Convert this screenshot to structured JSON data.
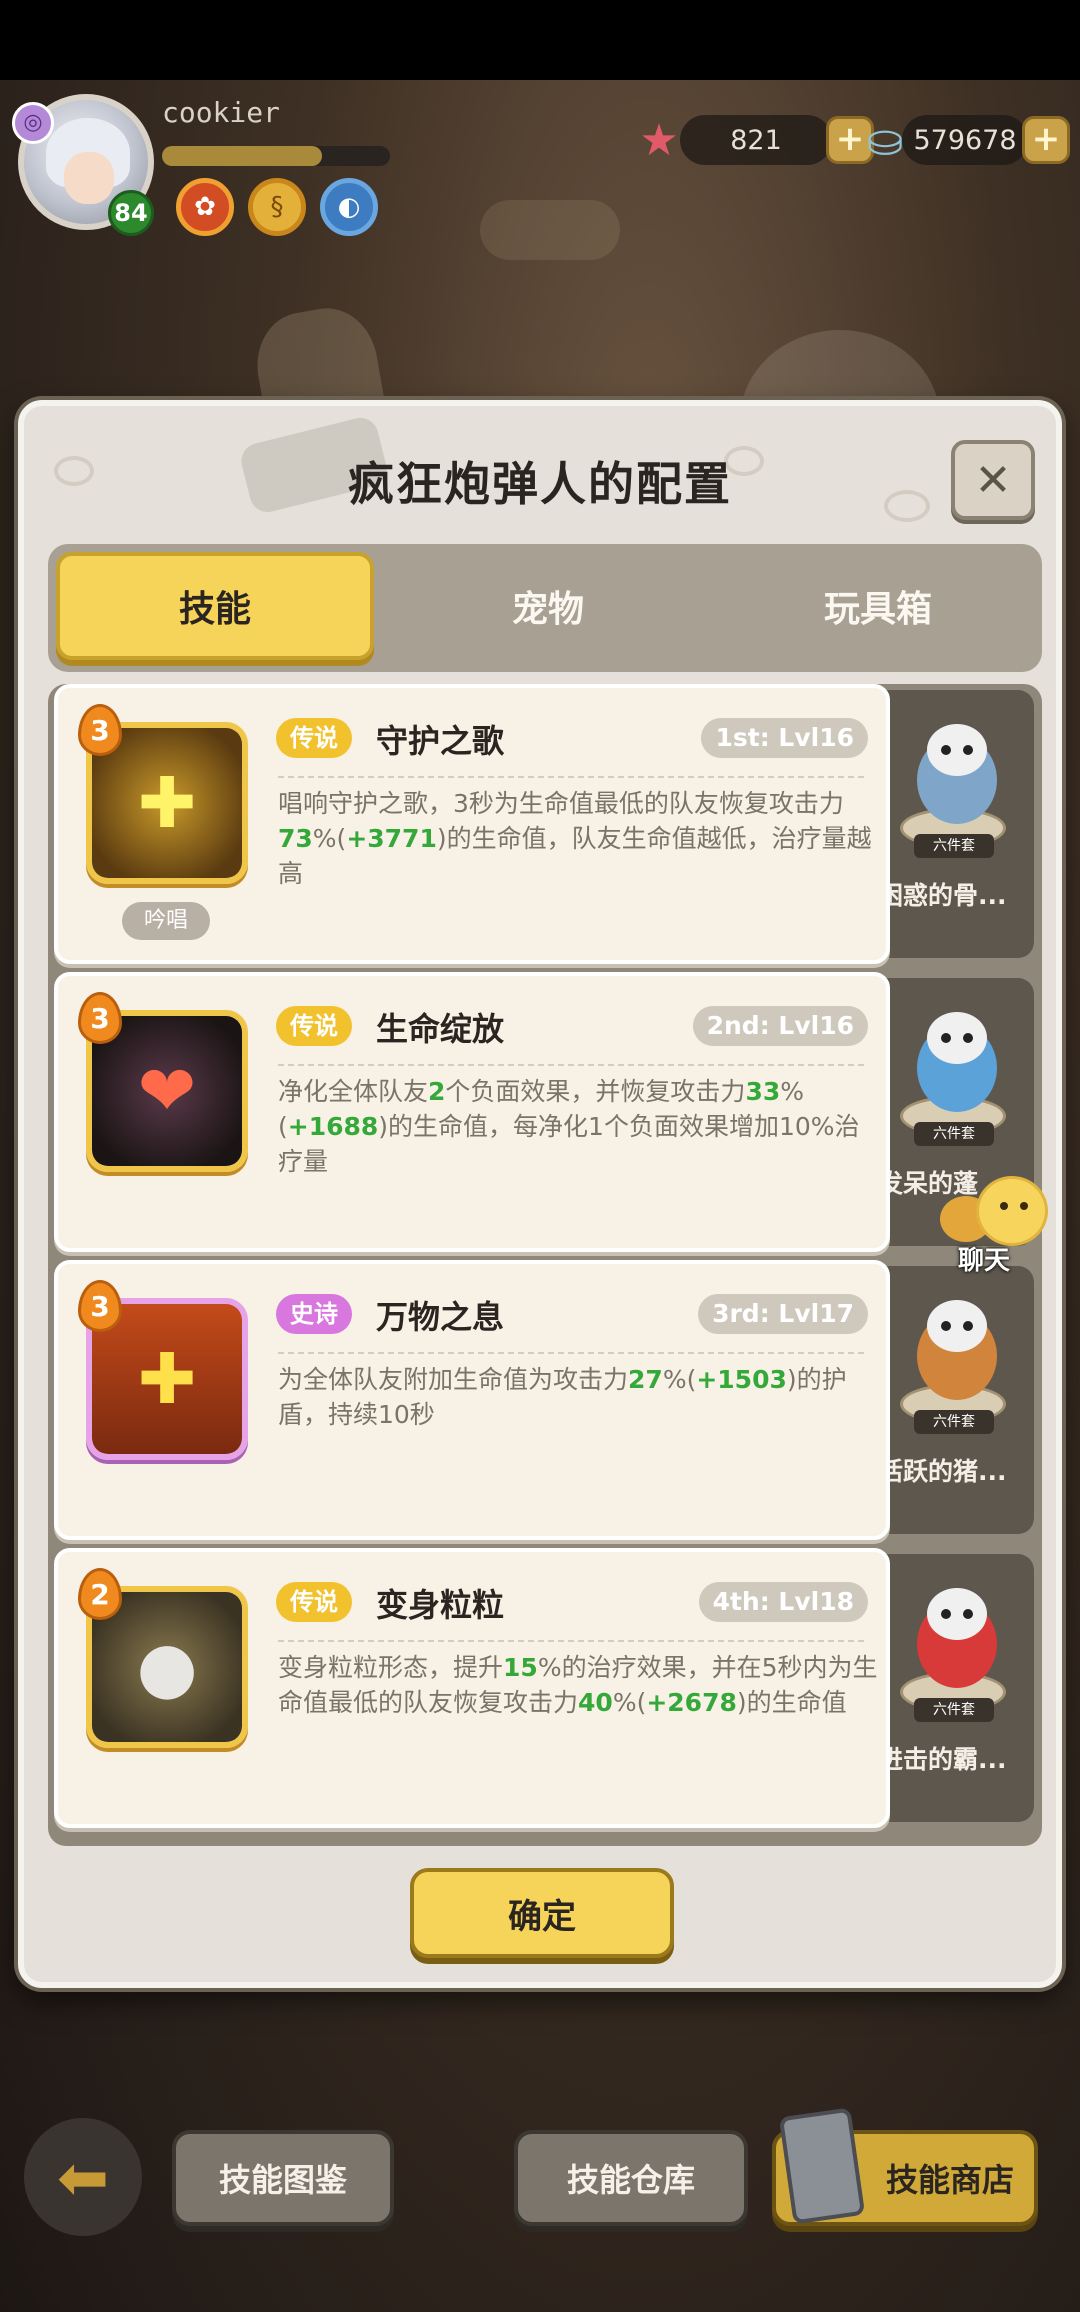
{
  "hud": {
    "username": "cookier",
    "level": "84",
    "xp_progress": 0.7,
    "currencies": [
      {
        "icon": "starfish-icon",
        "value": "821"
      },
      {
        "icon": "shell-icon",
        "value": "579678"
      }
    ]
  },
  "dialog": {
    "title": "疯狂炮弹人的配置",
    "tabs": [
      "技能",
      "宠物",
      "玩具箱"
    ],
    "active_tab": 0,
    "confirm_label": "确定"
  },
  "skills": [
    {
      "star": "3",
      "rarity": "传说",
      "rarity_type": "legend",
      "name": "守护之歌",
      "slot": "1st: Lvl16",
      "chant": "吟唱",
      "desc": [
        {
          "t": "唱响守护之歌，3秒为生命值最低的队友恢复攻击力"
        },
        {
          "t": "73",
          "h": true
        },
        {
          "t": "%("
        },
        {
          "t": "+3771",
          "h": true
        },
        {
          "t": ")的生命值，队友生命值越低，治疗量越高"
        }
      ]
    },
    {
      "star": "3",
      "rarity": "传说",
      "rarity_type": "legend",
      "name": "生命绽放",
      "slot": "2nd: Lvl16",
      "desc": [
        {
          "t": "净化全体队友"
        },
        {
          "t": "2",
          "h": true
        },
        {
          "t": "个负面效果，并恢复攻击力"
        },
        {
          "t": "33",
          "h": true
        },
        {
          "t": "%("
        },
        {
          "t": "+1688",
          "h": true
        },
        {
          "t": ")的生命值，每净化1个负面效果增加10%治疗量"
        }
      ]
    },
    {
      "star": "3",
      "rarity": "史诗",
      "rarity_type": "epic",
      "name": "万物之息",
      "slot": "3rd: Lvl17",
      "desc": [
        {
          "t": "为全体队友附加生命值为攻击力"
        },
        {
          "t": "27",
          "h": true
        },
        {
          "t": "%("
        },
        {
          "t": "+1503",
          "h": true
        },
        {
          "t": ")的护盾，持续10秒"
        }
      ]
    },
    {
      "star": "2",
      "rarity": "传说",
      "rarity_type": "legend",
      "name": "变身粒粒",
      "slot": "4th: Lvl18",
      "desc": [
        {
          "t": "变身粒粒形态，提升"
        },
        {
          "t": "15",
          "h": true
        },
        {
          "t": "%的治疗效果，并在5秒内为生命值最低的队友恢复攻击力"
        },
        {
          "t": "40",
          "h": true
        },
        {
          "t": "%("
        },
        {
          "t": "+2678",
          "h": true
        },
        {
          "t": ")的生命值"
        }
      ]
    }
  ],
  "pets": [
    {
      "name": "困惑的骨...",
      "tag": "六件套",
      "color": "#7fa6c9"
    },
    {
      "name": "发呆的蓬",
      "tag": "六件套",
      "color": "#5aa2d8"
    },
    {
      "name": "活跃的猪...",
      "tag": "六件套",
      "color": "#d0843c"
    },
    {
      "name": "进击的霸...",
      "tag": "六件套",
      "color": "#d83a3a"
    }
  ],
  "chat_label": "聊天",
  "bottom": {
    "wiki": "技能图鉴",
    "store": "技能仓库",
    "shop": "技能商店"
  },
  "colors": {
    "accent_yellow": "#f6d45a",
    "legend": "#f2c22e",
    "epic": "#d878df",
    "highlight_green": "#35a83a"
  }
}
